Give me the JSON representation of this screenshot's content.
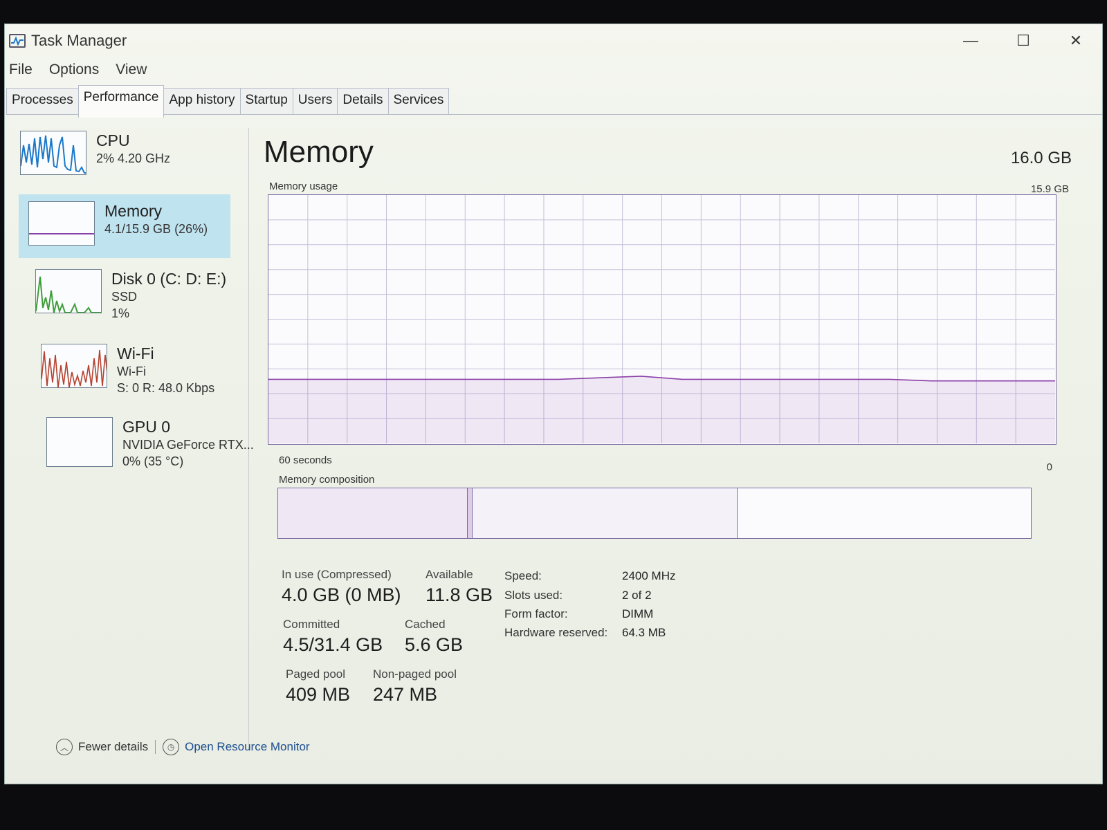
{
  "window": {
    "title": "Task Manager",
    "controls": {
      "minimize": "—",
      "maximize": "☐",
      "close": "✕"
    }
  },
  "menu": [
    "File",
    "Options",
    "View"
  ],
  "tabs": [
    "Processes",
    "Performance",
    "App history",
    "Startup",
    "Users",
    "Details",
    "Services"
  ],
  "active_tab": "Performance",
  "sidebar": {
    "items": [
      {
        "title": "CPU",
        "lines": [
          "2%  4.20 GHz"
        ]
      },
      {
        "title": "Memory",
        "lines": [
          "4.1/15.9 GB (26%)"
        ]
      },
      {
        "title": "Disk 0 (C: D: E:)",
        "lines": [
          "SSD",
          "1%"
        ]
      },
      {
        "title": "Wi-Fi",
        "lines": [
          "Wi-Fi",
          "S: 0  R: 48.0 Kbps"
        ]
      },
      {
        "title": "GPU 0",
        "lines": [
          "NVIDIA GeForce RTX...",
          "0% (35 °C)"
        ]
      }
    ]
  },
  "main": {
    "title": "Memory",
    "total": "16.0 GB",
    "usage_label": "Memory usage",
    "usage_max": "15.9 GB",
    "time_left": "60 seconds",
    "time_right": "0",
    "composition_label": "Memory composition"
  },
  "chart_data": {
    "type": "area",
    "title": "Memory usage",
    "xlabel": "",
    "ylabel": "",
    "x_range_seconds": [
      60,
      0
    ],
    "ylim": [
      0,
      15.9
    ],
    "unit": "GB",
    "series": [
      {
        "values": [
          4.1,
          4.1,
          4.1,
          4.1,
          4.1,
          4.1,
          4.1,
          4.1,
          4.2,
          4.3,
          4.1,
          4.1,
          4.1,
          4.1,
          4.1,
          4.1,
          4.0,
          4.0,
          4.0,
          4.0
        ]
      }
    ],
    "composition_segments": [
      {
        "segment": "in_use",
        "value_gb": 4.0
      },
      {
        "segment": "modified",
        "value_gb": 0.1
      },
      {
        "segment": "standby",
        "value_gb": 5.6
      },
      {
        "segment": "free",
        "value_gb": 6.2
      }
    ]
  },
  "stats": {
    "in_use_label": "In use (Compressed)",
    "in_use_value": "4.0 GB (0 MB)",
    "available_label": "Available",
    "available_value": "11.8 GB",
    "committed_label": "Committed",
    "committed_value": "4.5/31.4 GB",
    "cached_label": "Cached",
    "cached_value": "5.6 GB",
    "paged_label": "Paged pool",
    "paged_value": "409 MB",
    "nonpaged_label": "Non-paged pool",
    "nonpaged_value": "247 MB"
  },
  "specs": [
    {
      "label": "Speed:",
      "value": "2400 MHz"
    },
    {
      "label": "Slots used:",
      "value": "2 of 2"
    },
    {
      "label": "Form factor:",
      "value": "DIMM"
    },
    {
      "label": "Hardware reserved:",
      "value": "64.3 MB"
    }
  ],
  "footer": {
    "fewer_details": "Fewer details",
    "resource_monitor": "Open Resource Monitor"
  },
  "colors": {
    "memory_accent": "#8b3fa8",
    "selected_bg": "#bfe3ef",
    "link": "#1d4e8f",
    "cpu_line": "#1b78c9",
    "disk_line": "#3f9d3a",
    "wifi_line": "#b5412f"
  }
}
